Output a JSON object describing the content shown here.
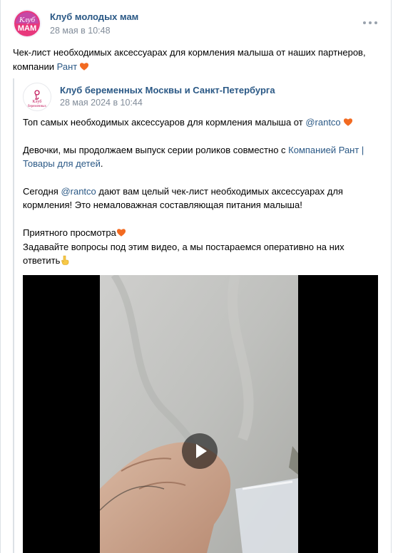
{
  "post": {
    "author": "Клуб молодых мам",
    "date": "28 мая в 10:48",
    "avatar_text": "Клуб МАМ",
    "text_before": "Чек-лист необходимых аксессуарах для кормления малыша от наших партнеров, компании ",
    "text_link": "Рант",
    "more_icon": "more-horizontal-icon"
  },
  "repost": {
    "author": "Клуб беременных Москвы и Санкт-Петербурга",
    "date": "28 мая 2024 в 10:44",
    "avatar_text": "Клуб беременных",
    "p1_before": "Топ самых необходимых аксессуаров для кормления малыша от ",
    "p1_link": "@rantco",
    "p2_before": "Девочки, мы продолжаем выпуск серии роликов совместно с ",
    "p2_link": "Компанией Рант | Товары для детей",
    "p2_after": ".",
    "p3_before": "Сегодня ",
    "p3_link": "@rantco",
    "p3_after": " дают вам целый чек-лист необходимых аксессуарах для кормления! Это немаловажная составляющая питания малыша!",
    "p4_line1": "Приятного просмотра",
    "p4_line2": "Задавайте вопросы под этим видео, а мы постараемся оперативно на них ответить"
  },
  "video": {
    "play_icon": "play-icon"
  },
  "colors": {
    "link": "#2a5885",
    "secondary_text": "#818c99",
    "avatar_main": "#d6175f",
    "avatar_repost": "#c2185b",
    "heart": "#f25c1d"
  }
}
